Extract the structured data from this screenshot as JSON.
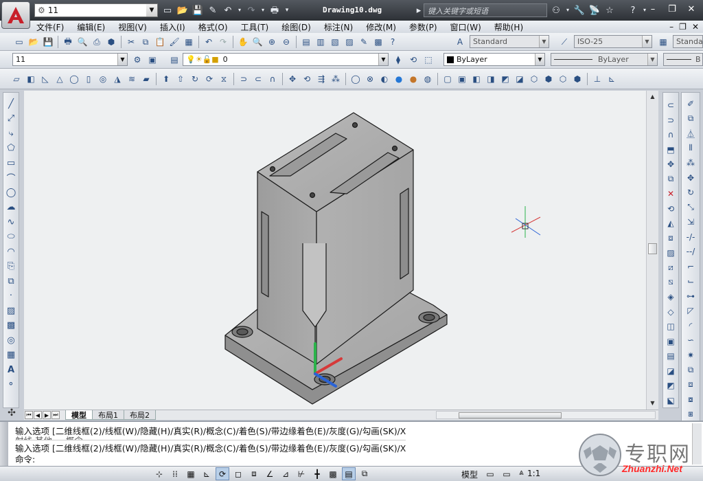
{
  "titlebar": {
    "workspace": "11",
    "document_title": "Drawing10.dwg",
    "search_placeholder": "键入关键字或短语"
  },
  "menu": [
    "文件(F)",
    "编辑(E)",
    "视图(V)",
    "插入(I)",
    "格式(O)",
    "工具(T)",
    "绘图(D)",
    "标注(N)",
    "修改(M)",
    "参数(P)",
    "窗口(W)",
    "帮助(H)"
  ],
  "styles": {
    "text_style": "Standard",
    "dim_style": "ISO-25",
    "table_style": "Standa"
  },
  "layers": {
    "workspace": "11",
    "layer": "0",
    "color": "ByLayer",
    "linetype": "ByLayer",
    "lineweight": "B"
  },
  "layout_tabs": [
    "模型",
    "布局1",
    "布局2"
  ],
  "command": {
    "line1": "输入选项 [二维线框(2)/线框(W)/隐藏(H)/真实(R)/概念(C)/着色(S)/带边缘着色(E)/灰度(G)/勾画(SK)/X",
    "line2": "射线   其他 ...     概念",
    "line3": "输入选项 [二维线框(2)/线框(W)/隐藏(H)/真实(R)/概念(C)/着色(S)/带边缘着色(E)/灰度(G)/勾画(SK)/X",
    "prompt": "命令:"
  },
  "status": {
    "model": "模型",
    "scale": "1:1"
  },
  "watermark": {
    "cn": "专职网",
    "en": "Zhuanzhi.Net"
  },
  "colors": {
    "accent_red": "#c8202a",
    "canvas": "#eef0f1",
    "solid": "#a8a8a8"
  }
}
